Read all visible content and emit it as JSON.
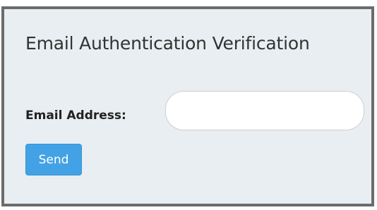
{
  "form": {
    "title": "Email Authentication Verification",
    "email_label": "Email Address:",
    "email_value": "",
    "email_placeholder": "",
    "send_label": "Send"
  }
}
